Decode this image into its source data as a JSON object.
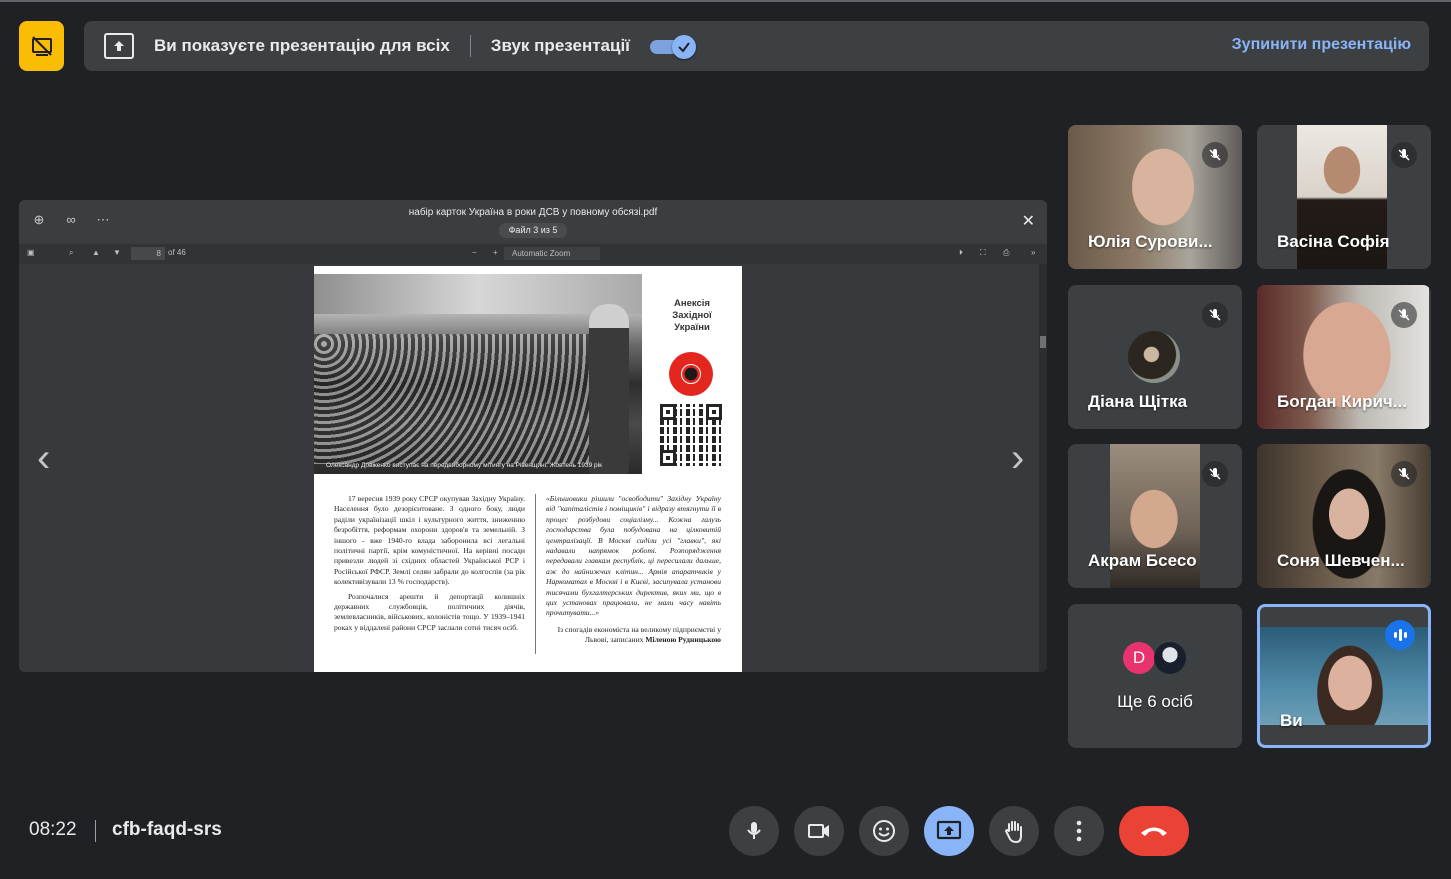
{
  "banner": {
    "presenting_text": "Ви показуєте презентацію для всіх",
    "audio_label": "Звук презентації",
    "audio_enabled": true,
    "stop_label": "Зупинити презентацію"
  },
  "viewer": {
    "file_title": "набір карток Україна в роки ДСВ у повному обсязі.pdf",
    "file_counter": "Файл 3 из 5",
    "page_number": "8",
    "page_total": "of 46",
    "zoom_label": "Automatic Zoom",
    "page": {
      "side_title": "Анексія Західної України",
      "photo_caption": "Олександр Довженко виступає на передвиборному мітингу на Рівенщині. Жовтень 1939 рік",
      "left_text_1": "17 вересня 1939 року СРСР окупував Західну Україну. Населення було дезорієнтоване. З одного боку, люди раділи українізації шкіл і культурного життя, зниженню безробіття, реформам охорони здоров'я та земельній. З іншого - вже 1940-го влада заборонила всі легальні політичні партії, крім комуністичної. На керівні посади привезли людей зі східних областей Української РСР і Російської РФСР. Землі селян забрали до колгоспів (за рік колективізували 13 % господарств).",
      "left_text_2": "Розпочалися арешти й депортації колишніх державних службовців, політичних діячів, землевласників, військових, колоністів тощо. У 1939–1941 роках у віддалені райони СРСР заслали сотні тисяч осіб.",
      "right_quote": "«Більшовики рішили \"освободити\" Західну Україну від \"капіталістів і поміщиків\" і відразу втягнути її в процес розбудови соціалізму... Кожна галузь господарства була побудована на цілковитій централізації. В Москві сиділи усі \"главки\", які надавали напрямок роботі. Розпорядження передавали главкам республік, ці пересилали дальше, аж до найнижчих клітин... Армія апаратчиків у Наркоматах в Москві і в Києві, засипувала установи тисячами бухгалтерських директив, яких ми, що в цих установах працювали, не мали часу навіть прочитувати...»",
      "right_source_1": "Із спогадів економіста на великому підприємстві у Львові, записаних",
      "right_source_2": "Міленою Рудницькою"
    }
  },
  "participants": [
    {
      "name": "Юлія Сурови...",
      "muted": true
    },
    {
      "name": "Васіна Софія",
      "muted": true
    },
    {
      "name": "Діана Щітка",
      "muted": true
    },
    {
      "name": "Богдан Кирич...",
      "muted": true
    },
    {
      "name": "Акрам Бсесо",
      "muted": true
    },
    {
      "name": "Соня Шевчен...",
      "muted": true
    },
    {
      "name": "Ще 6 осіб",
      "avatar_letter": "D",
      "avatar_color": "#e8336f"
    },
    {
      "name": "Ви",
      "speaking": true
    }
  ],
  "footer": {
    "time": "08:22",
    "meeting_code": "cfb-faqd-srs"
  },
  "controls": [
    "mic-icon",
    "camera-icon",
    "emoji-icon",
    "present-icon",
    "raise-hand-icon",
    "more-icon",
    "end-call-icon"
  ],
  "colors": {
    "accent": "#8ab4f8",
    "end_call": "#ea4335",
    "present_badge": "#fbbc04",
    "background": "#202124"
  }
}
